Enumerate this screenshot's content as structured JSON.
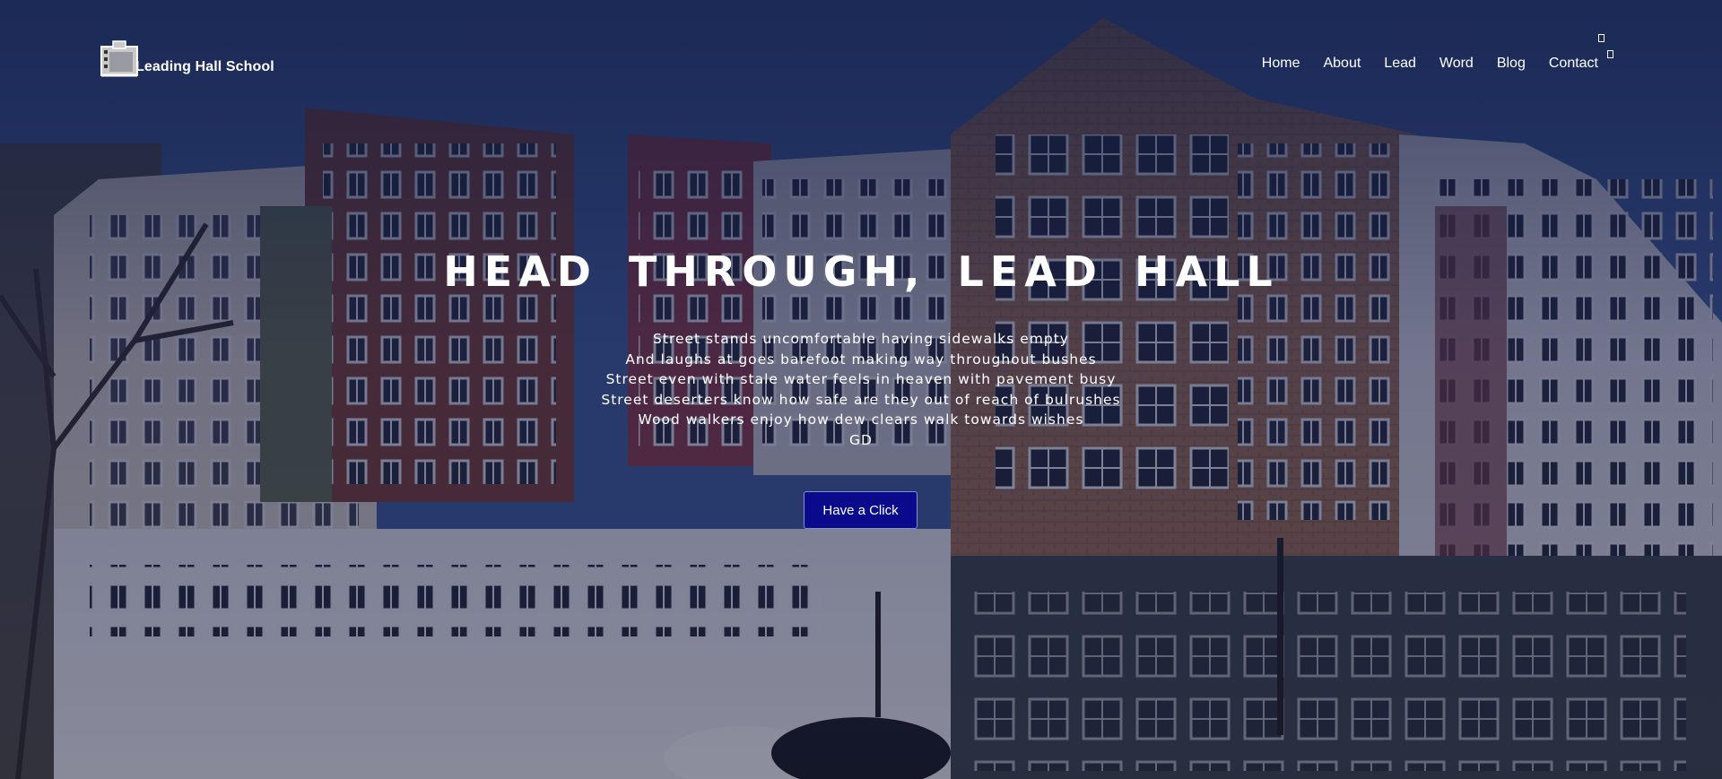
{
  "brand": {
    "name": "Leading Hall School",
    "logo_icon": "school-building-icon"
  },
  "nav": {
    "items": [
      {
        "label": "Home"
      },
      {
        "label": "About"
      },
      {
        "label": "Lead"
      },
      {
        "label": "Word"
      },
      {
        "label": "Blog"
      },
      {
        "label": "Contact"
      }
    ],
    "extra_icons": [
      "missing-glyph-icon",
      "missing-glyph-icon"
    ]
  },
  "hero": {
    "background": "apartment-buildings-photo",
    "headline": "HEAD THROUGH, LEAD HALL",
    "poem": [
      "Street stands uncomfortable having sidewalks empty",
      "And laughs at goes barefoot making way throughout bushes",
      "Street even with stale water feels in heaven with pavement busy",
      "Street deserters know how safe are they out of reach of bulrushes",
      "Wood walkers enjoy how dew clears walk towards wishes",
      "GD"
    ],
    "button_label": "Have a Click"
  },
  "colors": {
    "overlay": "#1a2346",
    "button": "#0a0a8c",
    "text": "#ffffff"
  }
}
